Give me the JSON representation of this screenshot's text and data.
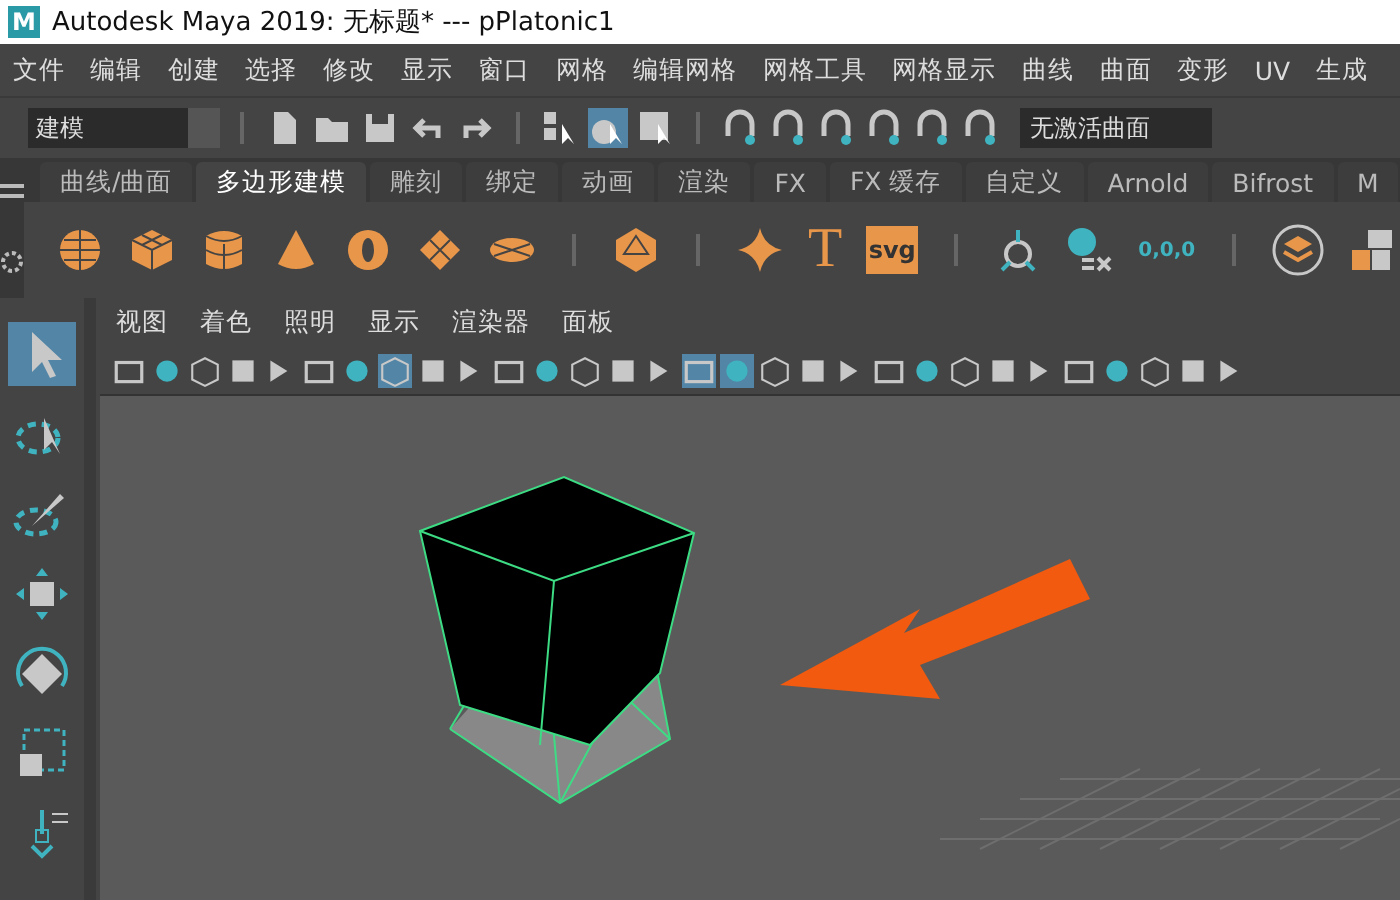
{
  "window": {
    "logo": "M",
    "title": "Autodesk Maya 2019: 无标题*    ---    pPlatonic1"
  },
  "menu": [
    "文件",
    "编辑",
    "创建",
    "选择",
    "修改",
    "显示",
    "窗口",
    "网格",
    "编辑网格",
    "网格工具",
    "网格显示",
    "曲线",
    "曲面",
    "变形",
    "UV",
    "生成"
  ],
  "toolbar": {
    "workspace": "建模",
    "select_modes": [
      {
        "selected": false
      },
      {
        "selected": true
      },
      {
        "selected": false
      }
    ],
    "curve_field": "无激活曲面"
  },
  "shelf": {
    "tabs": [
      {
        "label": "曲线/曲面",
        "selected": false
      },
      {
        "label": "多边形建模",
        "selected": true
      },
      {
        "label": "雕刻",
        "selected": false
      },
      {
        "label": "绑定",
        "selected": false
      },
      {
        "label": "动画",
        "selected": false
      },
      {
        "label": "渲染",
        "selected": false
      },
      {
        "label": "FX",
        "selected": false
      },
      {
        "label": "FX 缓存",
        "selected": false
      },
      {
        "label": "自定义",
        "selected": false
      },
      {
        "label": "Arnold",
        "selected": false
      },
      {
        "label": "Bifrost",
        "selected": false
      },
      {
        "label": "M",
        "selected": false
      }
    ],
    "text_tool": "T",
    "svg_tool": "svg",
    "freeze_label": "0,0,0"
  },
  "tools": [
    {
      "selected": true
    },
    {
      "selected": false
    },
    {
      "selected": false
    },
    {
      "selected": false
    },
    {
      "selected": false
    },
    {
      "selected": false
    },
    {
      "selected": false
    }
  ],
  "viewport": {
    "menu": [
      "视图",
      "着色",
      "照明",
      "显示",
      "渲染器",
      "面板"
    ],
    "toolbar": [
      {
        "selected": false
      },
      {
        "selected": false
      },
      {
        "selected": false
      },
      {
        "selected": false
      },
      {
        "selected": false
      },
      {
        "selected": false
      },
      {
        "selected": false
      },
      {
        "selected": true
      },
      {
        "selected": false
      },
      {
        "selected": false
      },
      {
        "selected": false
      },
      {
        "selected": false
      },
      {
        "selected": false
      },
      {
        "selected": false
      },
      {
        "selected": false
      },
      {
        "selected": true
      },
      {
        "selected": true
      },
      {
        "selected": false
      },
      {
        "selected": false
      },
      {
        "selected": false
      },
      {
        "selected": false
      },
      {
        "selected": false
      },
      {
        "selected": false
      },
      {
        "selected": false
      },
      {
        "selected": false
      },
      {
        "selected": false
      },
      {
        "selected": false
      },
      {
        "selected": false
      },
      {
        "selected": false
      },
      {
        "selected": false
      }
    ]
  }
}
